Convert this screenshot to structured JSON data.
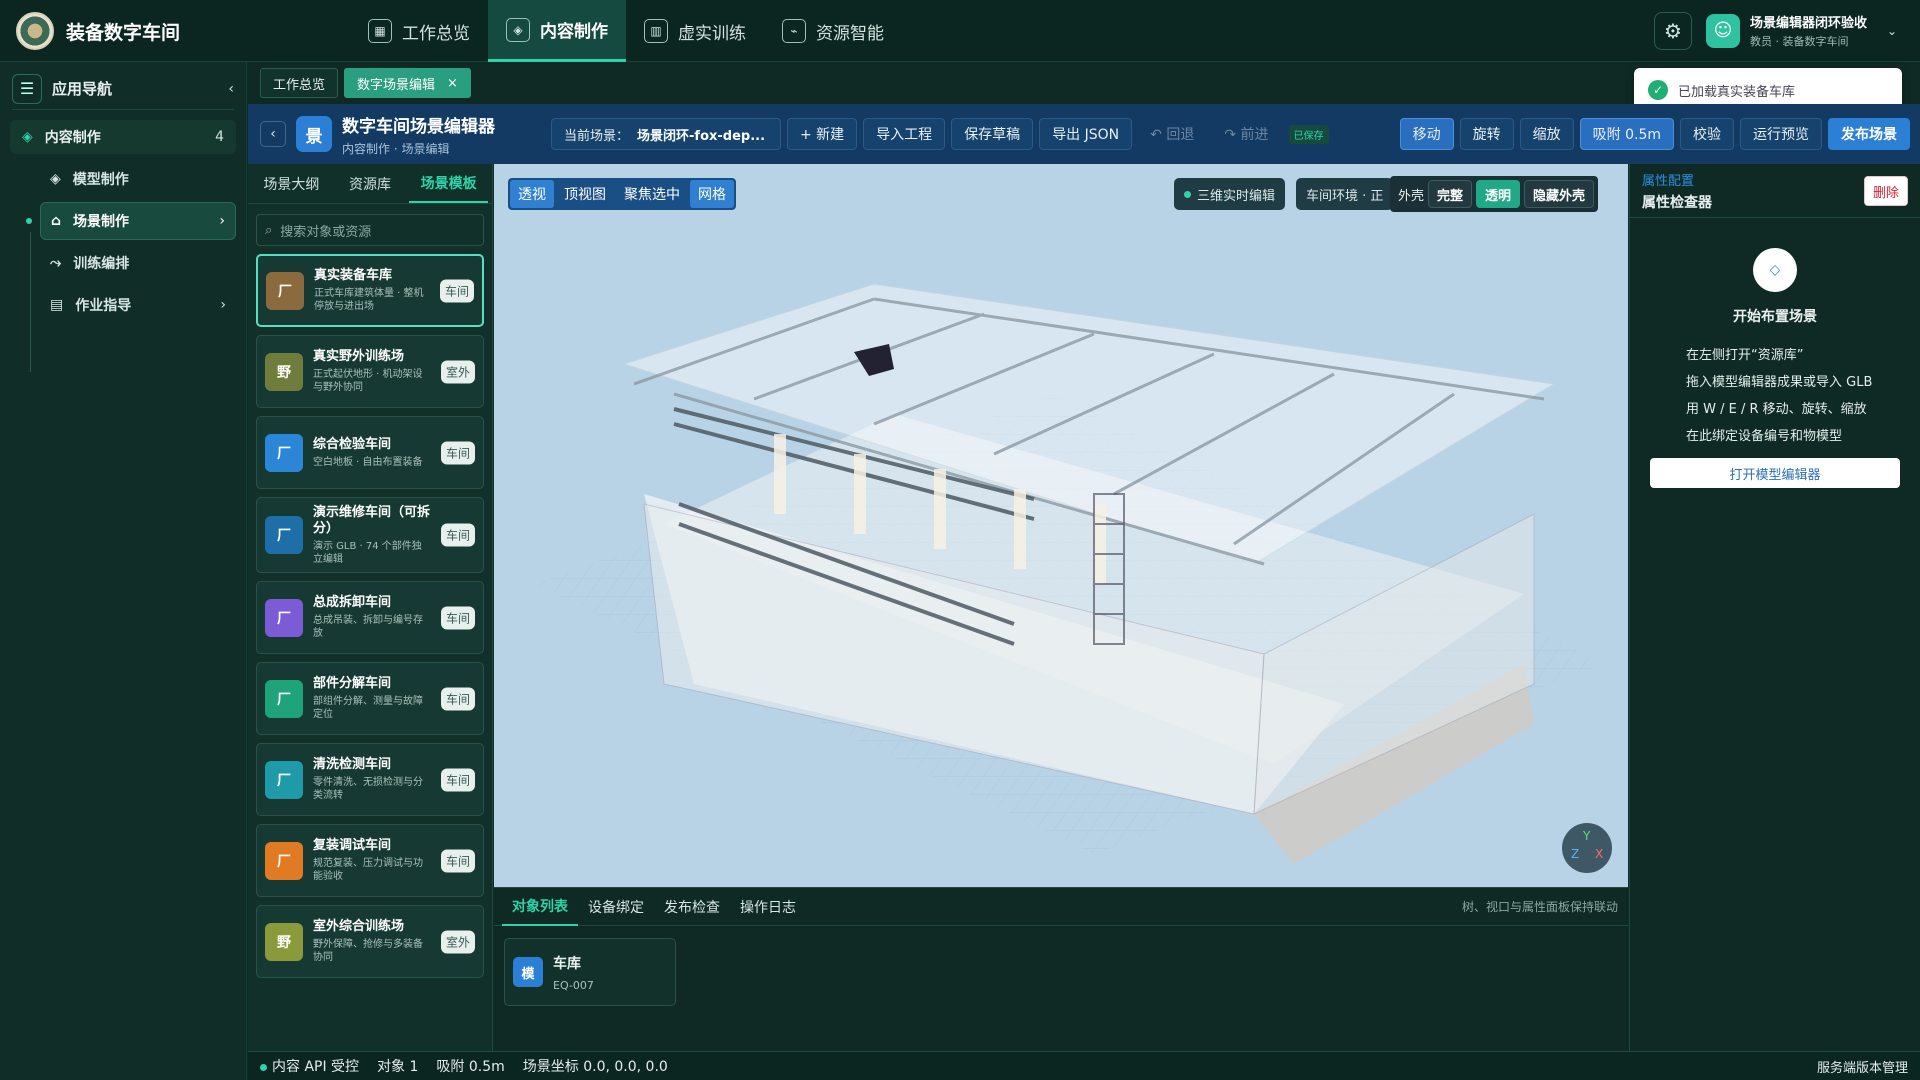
{
  "app": {
    "title": "装备数字车间"
  },
  "topnav": [
    {
      "label": "工作总览",
      "icon": "grid-icon"
    },
    {
      "label": "内容制作",
      "icon": "cube-icon",
      "active": true
    },
    {
      "label": "虚实训练",
      "icon": "book-icon"
    },
    {
      "label": "资源智能",
      "icon": "plug-icon"
    }
  ],
  "user": {
    "name": "场景编辑器闭环验收",
    "role": "教员 · 装备数字车间"
  },
  "sidebar": {
    "title": "应用导航",
    "group": {
      "label": "内容制作",
      "count": "4"
    },
    "items": [
      {
        "label": "模型制作"
      },
      {
        "label": "场景制作",
        "active": true,
        "chevron": "›"
      },
      {
        "label": "训练编排"
      },
      {
        "label": "作业指导",
        "chevron": "›"
      }
    ]
  },
  "tabs": [
    {
      "label": "工作总览"
    },
    {
      "label": "数字场景编辑",
      "close": "×"
    }
  ],
  "toast": {
    "text": "已加载真实装备车库"
  },
  "editor": {
    "badge": "景",
    "title": "数字车间场景编辑器",
    "breadcrumb": "内容制作 · 场景编辑",
    "scene_label": "当前场景：",
    "scene_value": "场景闭环-fox-dep...",
    "buttons": {
      "new": "+ 新建",
      "import": "导入工程",
      "save": "保存草稿",
      "export": "导出 JSON",
      "undo": "↶ 回退",
      "redo": "↷ 前进",
      "saved": "已保存",
      "move": "移动",
      "rotate": "旋转",
      "scale": "缩放",
      "snap": "吸附 0.5m",
      "check": "校验",
      "preview": "运行预览",
      "publish": "发布场景"
    }
  },
  "left_panel": {
    "tabs": [
      "场景大纲",
      "资源库",
      "场景模板"
    ],
    "search_placeholder": "搜索对象或资源",
    "cards": [
      {
        "icon": "厂",
        "color": "#8b6a3e",
        "title": "真实装备车库",
        "desc": "正式车库建筑体量 · 整机停放与进出场",
        "tag": "车间",
        "active": true
      },
      {
        "icon": "野",
        "color": "#6f7d3c",
        "title": "真实野外训练场",
        "desc": "正式起伏地形 · 机动架设与野外协同",
        "tag": "室外"
      },
      {
        "icon": "厂",
        "color": "#2b86d8",
        "title": "综合检验车间",
        "desc": "空白地板 · 自由布置装备",
        "tag": "车间"
      },
      {
        "icon": "厂",
        "color": "#1e6fa8",
        "title": "演示维修车间（可拆分）",
        "desc": "演示 GLB · 74 个部件独立编辑",
        "tag": "车间"
      },
      {
        "icon": "厂",
        "color": "#7b5bd6",
        "title": "总成拆卸车间",
        "desc": "总成吊装、拆卸与编号存放",
        "tag": "车间"
      },
      {
        "icon": "厂",
        "color": "#1fa37a",
        "title": "部件分解车间",
        "desc": "部组件分解、测量与故障定位",
        "tag": "车间"
      },
      {
        "icon": "厂",
        "color": "#1f9aa8",
        "title": "清洗检测车间",
        "desc": "零件清洗、无损检测与分类流转",
        "tag": "车间"
      },
      {
        "icon": "厂",
        "color": "#e07b23",
        "title": "复装调试车间",
        "desc": "规范复装、压力调试与功能验收",
        "tag": "车间"
      },
      {
        "icon": "野",
        "color": "#8a9a3a",
        "title": "室外综合训练场",
        "desc": "野外保障、抢修与多装备协同",
        "tag": "室外"
      }
    ]
  },
  "viewport": {
    "tools": [
      {
        "label": "透视",
        "on": true
      },
      {
        "label": "顶视图"
      },
      {
        "label": "聚焦选中"
      },
      {
        "label": "网格",
        "on": true
      }
    ],
    "live": "三维实时编辑",
    "env": "车间环境 · 正",
    "shell": {
      "label": "外壳",
      "full": "完整",
      "transparent": "透明",
      "hide": "隐藏外壳"
    },
    "axes": {
      "x": "X",
      "y": "Y",
      "z": "Z"
    }
  },
  "bottom": {
    "tabs": [
      "对象列表",
      "设备绑定",
      "发布检查",
      "操作日志"
    ],
    "hint": "树、视口与属性面板保持联动",
    "object": {
      "badge": "模",
      "name": "车库",
      "code": "EQ-007"
    }
  },
  "right": {
    "subtitle": "属性配置",
    "title": "属性检查器",
    "delete": "删除",
    "start_icon": "◇",
    "start_title": "开始布置场景",
    "steps": [
      "在左侧打开“资源库”",
      "拖入模型编辑器成果或导入 GLB",
      "用 W / E / R 移动、旋转、缩放",
      "在此绑定设备编号和物模型"
    ],
    "open_btn": "打开模型编辑器"
  },
  "status": {
    "api": "内容 API 受控",
    "objects": "对象 1",
    "snap": "吸附 0.5m",
    "coords": "场景坐标 0.0, 0.0, 0.0",
    "right": "服务端版本管理"
  }
}
